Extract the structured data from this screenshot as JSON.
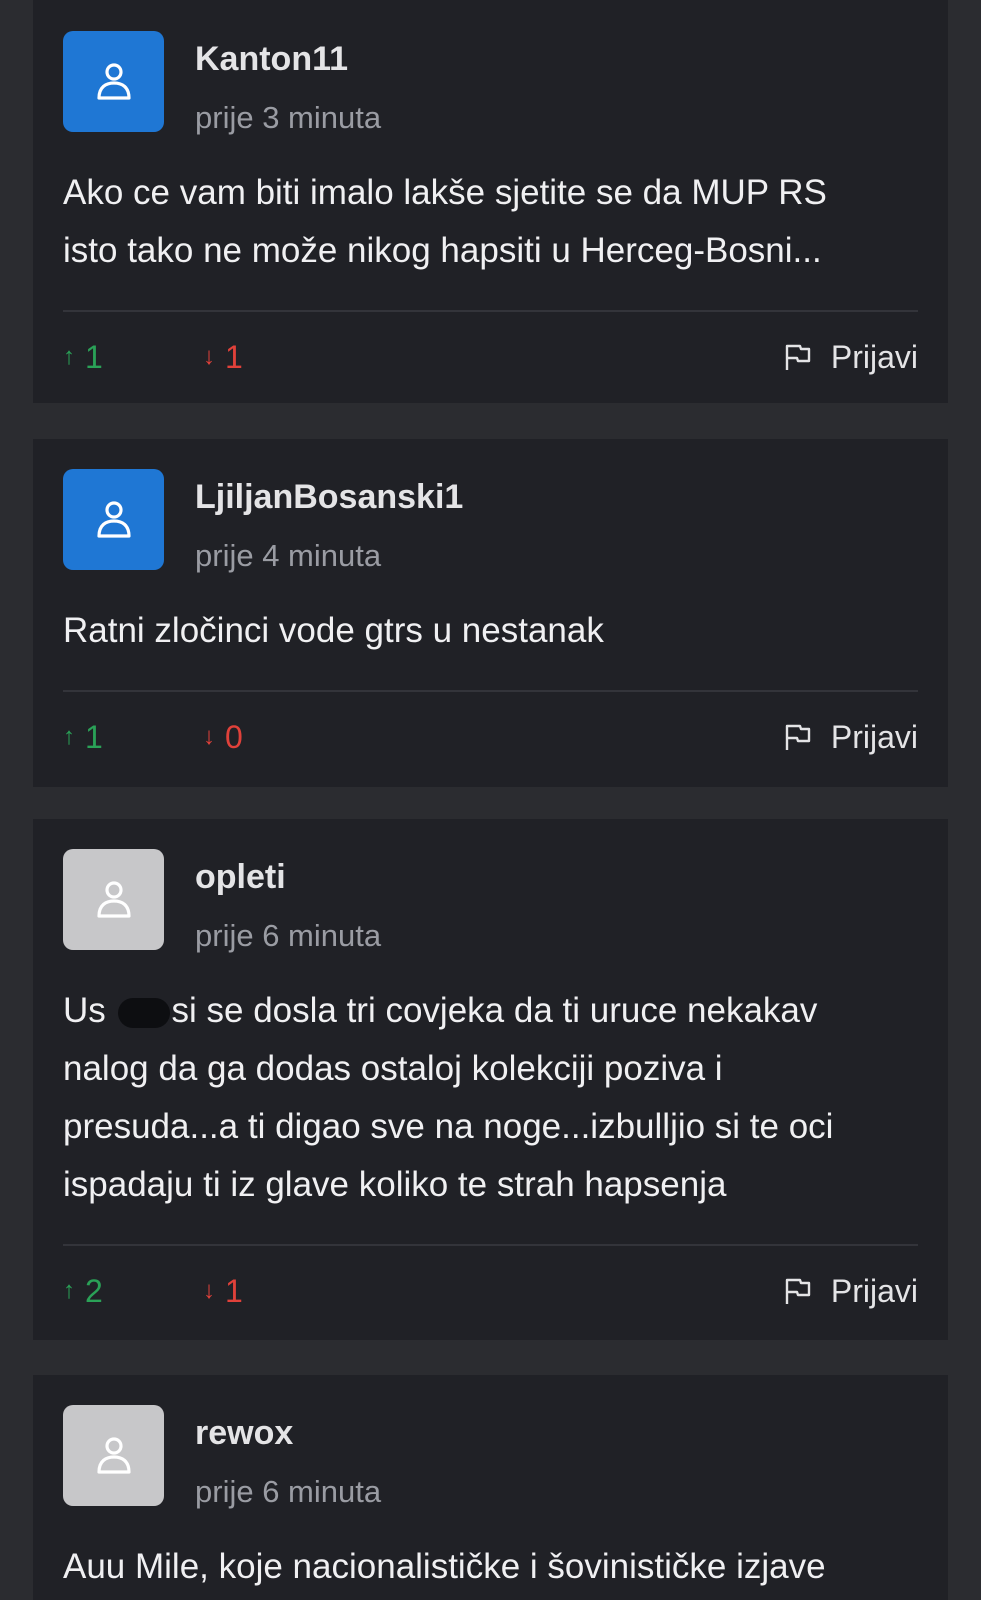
{
  "comments": [
    {
      "username": "Kanton11",
      "time": "prije 3 minuta",
      "text": "Ako ce vam biti imalo lakše sjetite se da MUP RS\nisto tako ne može nikog hapsiti u Herceg-Bosni...",
      "upvotes": "1",
      "downvotes": "1",
      "report_label": "Prijavi",
      "avatar_color": "#1f77d4"
    },
    {
      "username": "LjiljanBosanski1",
      "time": "prije 4 minuta",
      "text": "Ratni zločinci vode gtrs u nestanak",
      "upvotes": "1",
      "downvotes": "0",
      "report_label": "Prijavi",
      "avatar_color": "#1f77d4"
    },
    {
      "username": "opleti",
      "time": "prije 6 minuta",
      "text_before_redaction": "Us ",
      "text_after_redaction": "si se dosla tri covjeka da ti uruce nekakav\nnalog da ga dodas ostaloj kolekciji poziva i\npresuda...a ti digao sve na noge...izbulljio si te oci\nispadaju ti iz glave koliko te strah hapsenja",
      "upvotes": "2",
      "downvotes": "1",
      "report_label": "Prijavi",
      "avatar_color": "#c7c7c9"
    },
    {
      "username": "rewox",
      "time": "prije 6 minuta",
      "text": "Auu Mile, koje nacionalističke i šovinističke izjave",
      "avatar_color": "#c7c7c9"
    }
  ],
  "icons": {
    "avatar": "user-icon",
    "upvote": "↑",
    "downvote": "↓",
    "report": "flag-icon"
  },
  "colors": {
    "background": "#2b2c30",
    "card": "#202126",
    "upvote": "#2aa157",
    "downvote": "#e0413a"
  }
}
